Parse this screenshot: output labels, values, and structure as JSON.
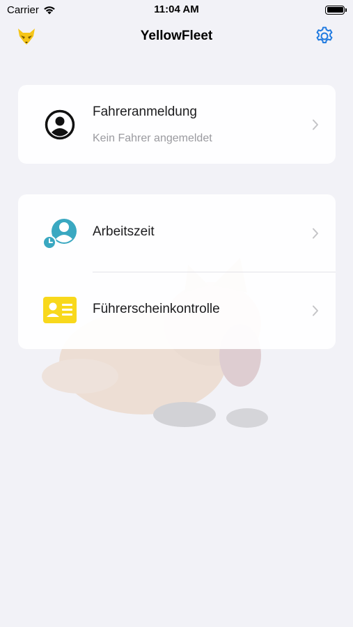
{
  "status_bar": {
    "carrier": "Carrier",
    "time": "11:04 AM",
    "battery_level": 1.0
  },
  "nav": {
    "title": "YellowFleet",
    "logo_icon": "fox-logo-icon",
    "settings_icon": "gear-icon",
    "accent_color": "#1f7ae0"
  },
  "driver_card": {
    "title": "Fahreranmeldung",
    "subtitle": "Kein Fahrer angemeldet",
    "icon": "user-circle-icon"
  },
  "menu": {
    "items": [
      {
        "label": "Arbeitszeit",
        "icon": "work-time-user-clock-icon",
        "icon_color": "#3aa8c1"
      },
      {
        "label": "Führerscheinkontrolle",
        "icon": "license-card-icon",
        "icon_color": "#f8d81c"
      }
    ]
  },
  "colors": {
    "background": "#f2f2f7",
    "card": "#ffffff",
    "secondary_text": "#9a9a9f",
    "chevron": "#c4c4c7"
  }
}
